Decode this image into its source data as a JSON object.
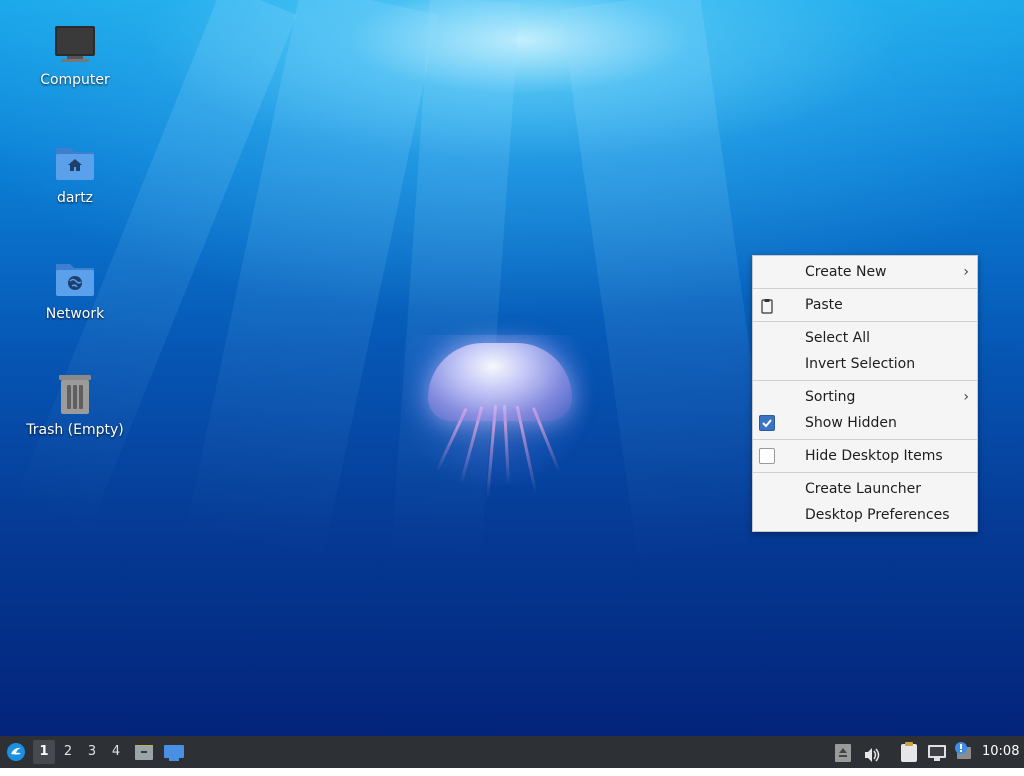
{
  "desktop": {
    "icons": [
      {
        "label": "Computer",
        "icon": "computer-icon"
      },
      {
        "label": "dartz",
        "icon": "home-folder-icon"
      },
      {
        "label": "Network",
        "icon": "network-folder-icon"
      },
      {
        "label": "Trash (Empty)",
        "icon": "trash-icon"
      }
    ]
  },
  "context_menu": {
    "items": [
      {
        "label": "Create New",
        "submenu": true
      },
      {
        "label": "Paste",
        "icon": "paste-icon"
      },
      {
        "label": "Select All"
      },
      {
        "label": "Invert Selection"
      },
      {
        "label": "Sorting",
        "submenu": true
      },
      {
        "label": "Show Hidden",
        "checked": true
      },
      {
        "label": "Hide Desktop Items",
        "checked": false
      },
      {
        "label": "Create Launcher"
      },
      {
        "label": "Desktop Preferences"
      }
    ],
    "submenu_arrow": "›"
  },
  "taskbar": {
    "menu_icon": "lubuntu-menu-icon",
    "workspaces": [
      "1",
      "2",
      "3",
      "4"
    ],
    "active_workspace": "1",
    "launchers": [
      "file-manager-icon",
      "show-desktop-icon"
    ],
    "tray": [
      "eject-icon",
      "volume-icon",
      "clipboard-icon",
      "network-icon",
      "update-notifier-icon"
    ],
    "clock": "10:08"
  },
  "colors": {
    "taskbar_bg": "#2d3035",
    "menu_bg": "#f5f5f5",
    "check_accent": "#3b73c4"
  }
}
